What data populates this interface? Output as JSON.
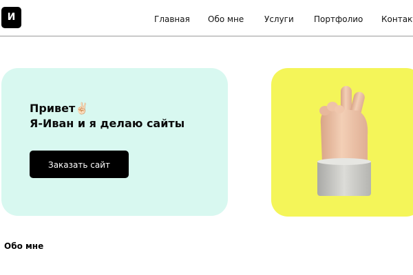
{
  "header": {
    "logo_text": "И",
    "nav": [
      "Главная",
      "Обо мне",
      "Услуги",
      "Портфолио",
      "Контакт"
    ]
  },
  "hero": {
    "greeting": "Привет✌🏻",
    "subtitle": "Я-Иван и я делаю сайты",
    "cta_label": "Заказать сайт",
    "background_color": "#d8f8f0"
  },
  "image_card": {
    "icon": "victory-hand-icon",
    "background_color": "#f4f559"
  },
  "about": {
    "heading": "Обо мне"
  },
  "colors": {
    "accent": "#000000",
    "text": "#0b0b0b"
  }
}
